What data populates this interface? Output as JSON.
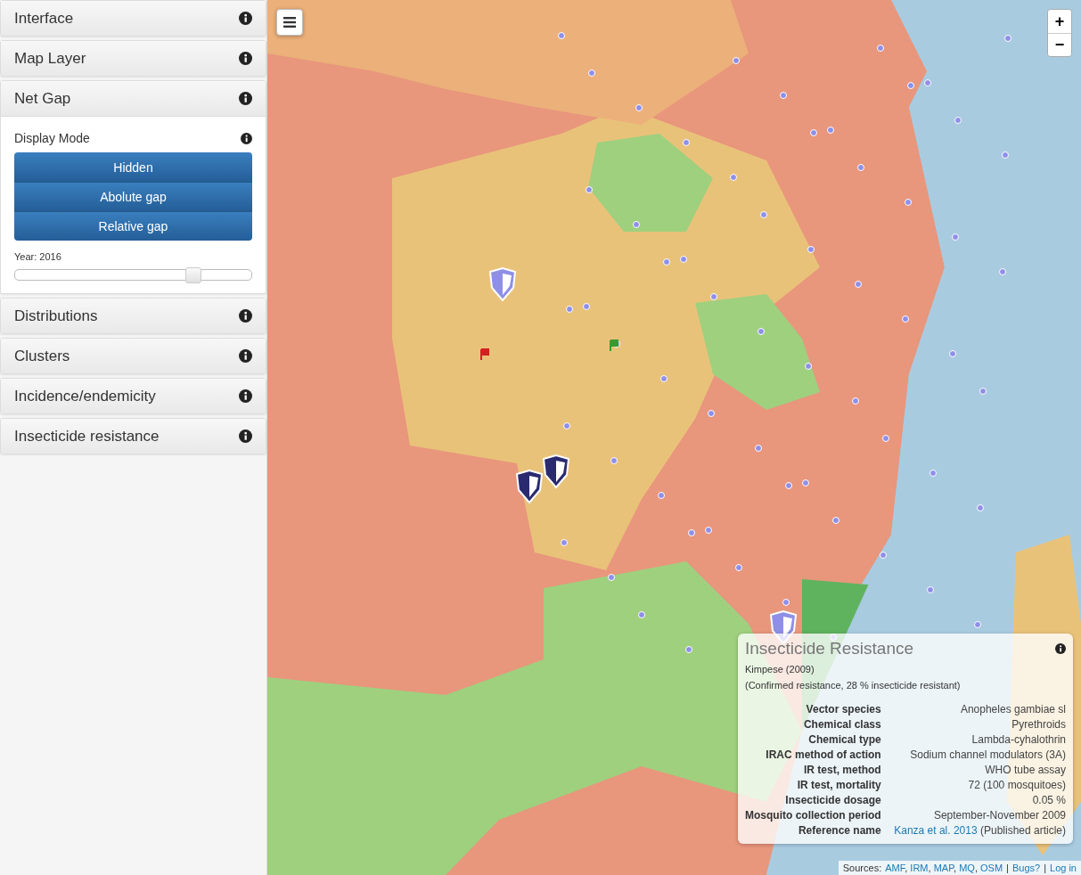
{
  "sidebar": {
    "panels": [
      {
        "title": "Interface",
        "expanded": false
      },
      {
        "title": "Map Layer",
        "expanded": false
      },
      {
        "title": "Net Gap",
        "expanded": true,
        "content": {
          "label": "Display Mode",
          "buttons": [
            "Hidden",
            "Abolute gap",
            "Relative gap"
          ],
          "slider": {
            "label": "Year: 2016",
            "level": 0.75
          }
        }
      },
      {
        "title": "Distributions",
        "expanded": false
      },
      {
        "title": "Clusters",
        "expanded": false
      },
      {
        "title": "Incidence/endemicity",
        "expanded": false
      },
      {
        "title": "Insecticide resistance",
        "expanded": false
      }
    ]
  },
  "map": {
    "zoom_in": "+",
    "zoom_out": "−",
    "popup": {
      "title": "Insecticide Resistance",
      "subtitle": "Kimpese (2009)",
      "summary": "(Confirmed resistance, 28 % insecticide resistant)",
      "rows": [
        {
          "kind": "text",
          "label": "Vector species",
          "value": "Anopheles gambiae sl"
        },
        {
          "kind": "text",
          "label": "Chemical class",
          "value": "Pyrethroids"
        },
        {
          "kind": "text",
          "label": "Chemical type",
          "value": "Lambda-cyhalothrin"
        },
        {
          "kind": "text",
          "label": "IRAC method of action",
          "value": "Sodium channel modulators (3A)"
        },
        {
          "kind": "text",
          "label": "IR test, method",
          "value": "WHO tube assay"
        },
        {
          "kind": "text",
          "label": "IR test, mortality",
          "value": "72 (100 mosquitoes)"
        },
        {
          "kind": "text",
          "label": "Insecticide dosage",
          "value": "0.05 %"
        },
        {
          "kind": "text",
          "label": "Mosquito collection period",
          "value": "September-November 2009"
        },
        {
          "kind": "link",
          "label": "Reference name",
          "link": "Kanza et al. 2013",
          "value": "(Published article)"
        }
      ]
    },
    "attribution": {
      "prefix": "Sources:",
      "links": [
        "AMF",
        "IRM",
        "MAP",
        "MQ",
        "OSM"
      ],
      "separator": ",",
      "divider": "|",
      "extra_links": [
        "Bugs?",
        "Log in"
      ]
    }
  }
}
